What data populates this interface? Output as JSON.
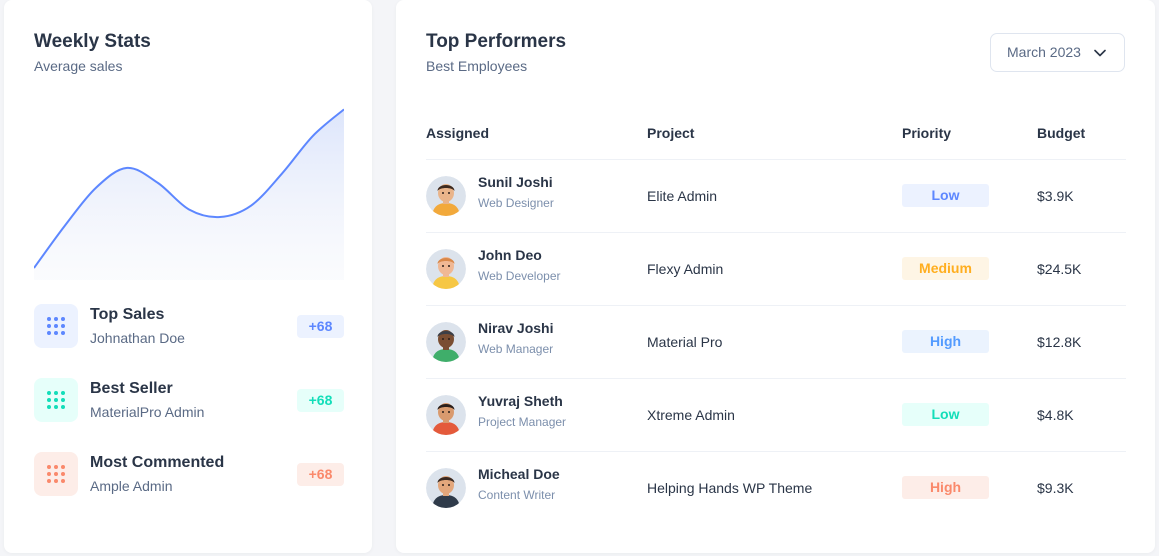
{
  "weekly_stats": {
    "title": "Weekly Stats",
    "subtitle": "Average sales",
    "chart_data": {
      "type": "area",
      "x": [
        0,
        1,
        2,
        3,
        4,
        5,
        6,
        7,
        8,
        9,
        10
      ],
      "values": [
        0,
        45,
        85,
        106,
        90,
        62,
        54,
        66,
        100,
        140,
        168
      ],
      "ylim": [
        0,
        180
      ],
      "color": "#5d87ff",
      "fill": "#e8edfc",
      "grid": false
    },
    "stats": [
      {
        "name": "Top Sales",
        "desc": "Johnathan Doe",
        "badge": "+68",
        "icon": "grid-dots-icon",
        "color": "#5d87ff",
        "bg": "#ecf2ff"
      },
      {
        "name": "Best Seller",
        "desc": "MaterialPro Admin",
        "badge": "+68",
        "icon": "grid-dots-icon",
        "color": "#13deb9",
        "bg": "#e6fffa"
      },
      {
        "name": "Most Commented",
        "desc": "Ample Admin",
        "badge": "+68",
        "icon": "grid-dots-icon",
        "color": "#fa896b",
        "bg": "#fdede8"
      }
    ]
  },
  "top_performers": {
    "title": "Top Performers",
    "subtitle": "Best Employees",
    "month_select": {
      "value": "March 2023",
      "icon": "chevron-down-icon"
    },
    "columns": [
      "Assigned",
      "Project",
      "Priority",
      "Budget"
    ],
    "rows": [
      {
        "name": "Sunil Joshi",
        "role": "Web Designer",
        "project": "Elite Admin",
        "priority": "Low",
        "priority_color": "#5d87ff",
        "priority_bg": "#ecf2ff",
        "budget": "$3.9K",
        "avatar": {
          "skin": "#e9b48a",
          "hair": "#3d2a1f",
          "shirt": "#f2a93b",
          "bg": "#dce3ec"
        }
      },
      {
        "name": "John Deo",
        "role": "Web Developer",
        "project": "Flexy Admin",
        "priority": "Medium",
        "priority_color": "#ffae1f",
        "priority_bg": "#fef5e5",
        "budget": "$24.5K",
        "avatar": {
          "skin": "#f0b894",
          "hair": "#d9884a",
          "shirt": "#f6c744",
          "bg": "#dce3ec"
        }
      },
      {
        "name": "Nirav Joshi",
        "role": "Web Manager",
        "project": "Material Pro",
        "priority": "High",
        "priority_color": "#539bff",
        "priority_bg": "#ebf3fe",
        "budget": "$12.8K",
        "avatar": {
          "skin": "#7a4e32",
          "hair": "#3b3f47",
          "shirt": "#3fae6a",
          "bg": "#dce3ec"
        }
      },
      {
        "name": "Yuvraj Sheth",
        "role": "Project Manager",
        "project": "Xtreme Admin",
        "priority": "Low",
        "priority_color": "#13deb9",
        "priority_bg": "#e6fffa",
        "budget": "$4.8K",
        "avatar": {
          "skin": "#d99a6e",
          "hair": "#2a1e1a",
          "shirt": "#e45a3b",
          "bg": "#dce3ec"
        }
      },
      {
        "name": "Micheal Doe",
        "role": "Content Writer",
        "project": "Helping Hands WP Theme",
        "priority": "High",
        "priority_color": "#fa896b",
        "priority_bg": "#fdede8",
        "budget": "$9.3K",
        "avatar": {
          "skin": "#e3a77c",
          "hair": "#3a2a22",
          "shirt": "#2f3b4a",
          "bg": "#dce3ec"
        }
      }
    ]
  }
}
